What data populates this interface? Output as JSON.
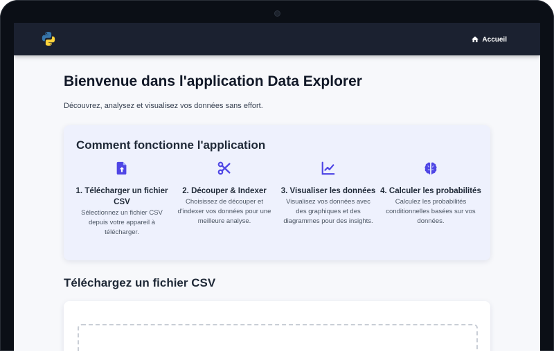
{
  "nav": {
    "home_label": "Accueil"
  },
  "header": {
    "title": "Bienvenue dans l'application Data Explorer",
    "subtitle": "Découvrez, analysez et visualisez vos données sans effort."
  },
  "how_it_works": {
    "title": "Comment fonctionne l'application",
    "steps": [
      {
        "icon": "file-upload-icon",
        "title": "1. Télécharger un fichier CSV",
        "description": "Sélectionnez un fichier CSV depuis votre appareil à télécharger."
      },
      {
        "icon": "scissors-icon",
        "title": "2. Découper & Indexer",
        "description": "Choisissez de découper et d'indexer vos données pour une meilleure analyse."
      },
      {
        "icon": "line-chart-icon",
        "title": "3. Visualiser les données",
        "description": "Visualisez vos données avec des graphiques et des diagrammes pour des insights."
      },
      {
        "icon": "brain-icon",
        "title": "4. Calculer les probabilités",
        "description": "Calculez les probabilités conditionnelles basées sur vos données."
      }
    ]
  },
  "upload": {
    "title": "Téléchargez un fichier CSV"
  },
  "colors": {
    "navbar": "#1b2130",
    "accent": "#4f46e5",
    "card_bg": "#eef1fd",
    "python_blue": "#3776ab",
    "python_yellow": "#ffd43b"
  }
}
